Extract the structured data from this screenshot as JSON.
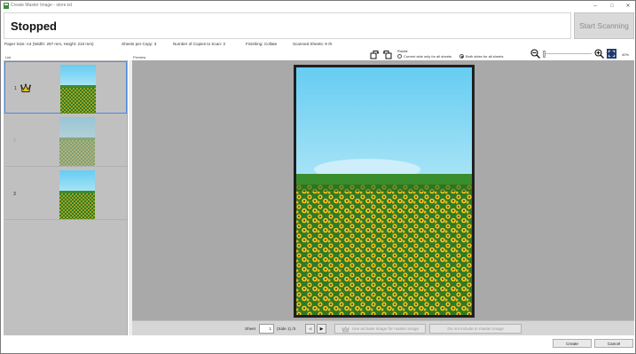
{
  "window": {
    "title": "Create Master Image - store.txt",
    "controls": {
      "minimize": "─",
      "maximize": "□",
      "close": "✕"
    }
  },
  "status": {
    "text": "Stopped"
  },
  "start_button": {
    "label": "Start Scanning"
  },
  "info": {
    "paper_size": "Paper Size:  A4  (Width: 297 mm, Height: 210 mm)",
    "sheets_per_copy": "Sheets per Copy:  3",
    "copies_to_scan": "Number of Copies to Scan:  3",
    "finishing": "Finishing:  Collate",
    "scanned_sheets": "Scanned Sheets:  9 /9"
  },
  "rotate": {
    "label": "Rotate",
    "option_current": "Current side only for all sheets",
    "option_both": "Both sides for all sheets",
    "selected": "both"
  },
  "zoom": {
    "percent": "40%",
    "level": 0.06
  },
  "list": {
    "label": "List",
    "items": [
      {
        "number": "1",
        "selected": true,
        "is_base": true,
        "dimmed": false
      },
      {
        "number": "2",
        "selected": false,
        "is_base": false,
        "dimmed": true
      },
      {
        "number": "3",
        "selected": false,
        "is_base": false,
        "dimmed": false
      }
    ]
  },
  "preview": {
    "label": "Preview"
  },
  "sheet_nav": {
    "label": "Sheet",
    "value": "1",
    "side": "(Side 1)  /3",
    "prev": "◀",
    "next": "▶"
  },
  "actions": {
    "use_as_base": "Use as base image for master image",
    "exclude": "Do not include in master image"
  },
  "footer": {
    "create": "Create",
    "cancel": "Cancel"
  },
  "colors": {
    "accent": "#4a8be0",
    "sky": "#7fd6f4",
    "field": "#2f7a26",
    "flower": "#f2c21d"
  }
}
